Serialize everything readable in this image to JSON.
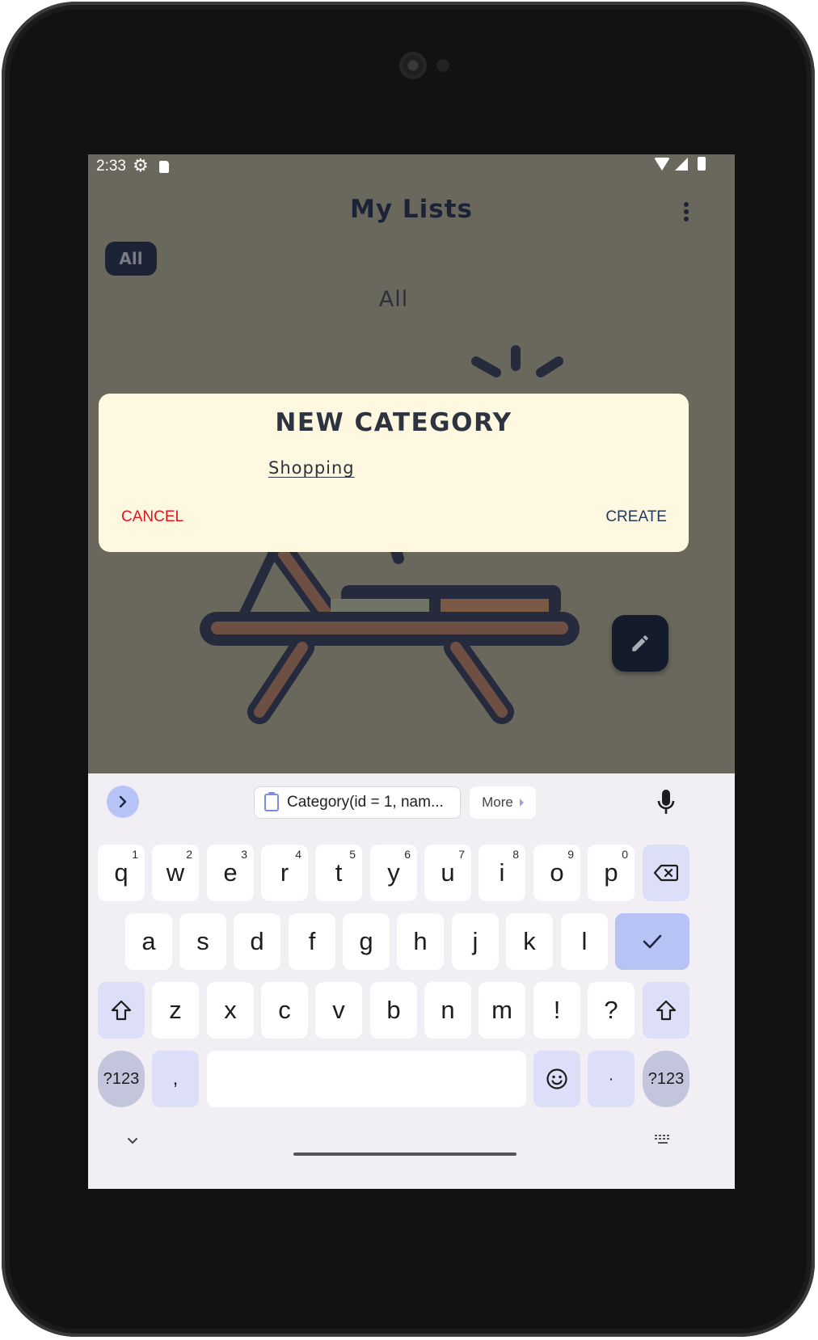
{
  "status_bar": {
    "time": "2:33"
  },
  "app_bar": {
    "title": "My Lists"
  },
  "filter_chip": {
    "label": "All"
  },
  "section": {
    "label": "All"
  },
  "dialog": {
    "title": "NEW CATEGORY",
    "input_value": "Shopping",
    "cancel_label": "CANCEL",
    "create_label": "CREATE",
    "cancel_color": "#e4131e"
  },
  "keyboard": {
    "clipboard_suggestion": "Category(id = 1,  nam...",
    "more_label": "More",
    "row1": [
      {
        "key": "q",
        "hint": "1"
      },
      {
        "key": "w",
        "hint": "2"
      },
      {
        "key": "e",
        "hint": "3"
      },
      {
        "key": "r",
        "hint": "4"
      },
      {
        "key": "t",
        "hint": "5"
      },
      {
        "key": "y",
        "hint": "6"
      },
      {
        "key": "u",
        "hint": "7"
      },
      {
        "key": "i",
        "hint": "8"
      },
      {
        "key": "o",
        "hint": "9"
      },
      {
        "key": "p",
        "hint": "0"
      }
    ],
    "row2": [
      "a",
      "s",
      "d",
      "f",
      "g",
      "h",
      "j",
      "k",
      "l"
    ],
    "row3": [
      "z",
      "x",
      "c",
      "v",
      "b",
      "n",
      "m",
      "!",
      "?"
    ],
    "symbols_label": "?123",
    "comma_label": ",",
    "period_label": "·",
    "accent_color": "#b8c3f5"
  }
}
